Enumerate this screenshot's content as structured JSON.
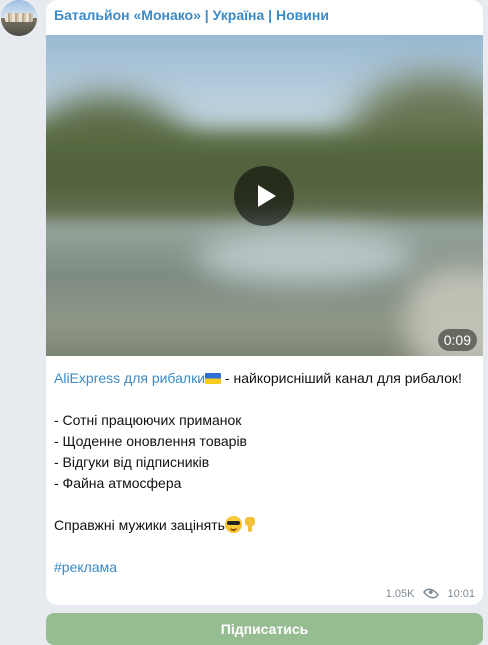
{
  "channel": {
    "name": "Батальйон «Монако» | Україна | Новини"
  },
  "video": {
    "duration": "0:09"
  },
  "post": {
    "link_text": "AliExpress для рибалки",
    "flag_icon": "ukraine-flag-icon",
    "intro_rest": " - найкорисніший канал для рибалок!",
    "bullets": [
      "- Сотні працюючих приманок",
      "- Щоденне оновлення товарів",
      "- Відгуки від підписників",
      "- Файна атмосфера"
    ],
    "closing": "Справжні мужики зацінять",
    "closing_icons": [
      "sunglasses-emoji-icon",
      "pointing-down-emoji-icon"
    ],
    "hashtag": "#реклама"
  },
  "meta": {
    "views": "1.05K",
    "time": "10:01"
  },
  "subscribe_button": {
    "label": "Підписатись"
  },
  "colors": {
    "link": "#3a8bc6",
    "bubble": "#ffffff",
    "background": "#e7ebf0",
    "button": "#96bc92"
  }
}
